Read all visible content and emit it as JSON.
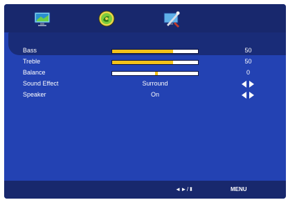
{
  "tabs": [
    {
      "name": "picture",
      "icon": "tv-picture-icon"
    },
    {
      "name": "sound",
      "icon": "sound-disc-icon",
      "selected": true
    },
    {
      "name": "setup",
      "icon": "tools-icon"
    }
  ],
  "rows": {
    "bass": {
      "label": "Bass",
      "value": "50",
      "level_percent": 71
    },
    "treble": {
      "label": "Treble",
      "value": "50",
      "level_percent": 71
    },
    "balance": {
      "label": "Balance",
      "value": "0",
      "position_percent": 52
    },
    "sound_effect": {
      "label": "Sound Effect",
      "value": "Surround"
    },
    "speaker": {
      "label": "Speaker",
      "value": "On"
    }
  },
  "footer": {
    "nav_hint": "◄►/⬍",
    "menu": "MENU"
  },
  "colors": {
    "background": "#2342b3",
    "bars": "#18286d",
    "slider_fill": "#f3c21a"
  }
}
